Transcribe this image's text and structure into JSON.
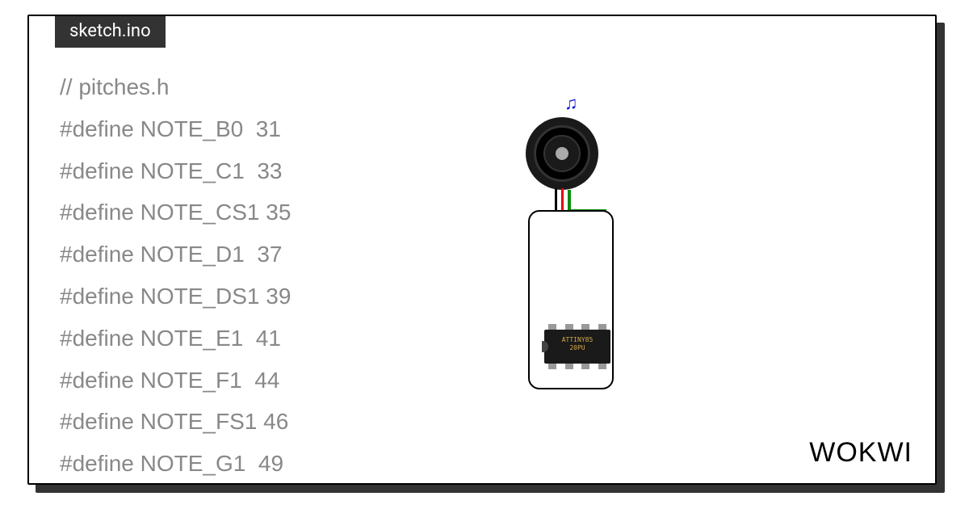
{
  "tab": {
    "filename": "sketch.ino"
  },
  "code": {
    "lines": [
      "// pitches.h",
      "#define NOTE_B0  31",
      "#define NOTE_C1  33",
      "#define NOTE_CS1 35",
      "#define NOTE_D1  37",
      "#define NOTE_DS1 39",
      "#define NOTE_E1  41",
      "#define NOTE_F1  44",
      "#define NOTE_FS1 46",
      "#define NOTE_G1  49"
    ]
  },
  "diagram": {
    "music_glyph": "♫",
    "chip": {
      "line1": "ATTINY85",
      "line2": "20PU"
    },
    "wires": {
      "black": "#000000",
      "red": "#e60000",
      "green": "#0a8f0a"
    }
  },
  "branding": {
    "logo_text": "WOKWI"
  }
}
